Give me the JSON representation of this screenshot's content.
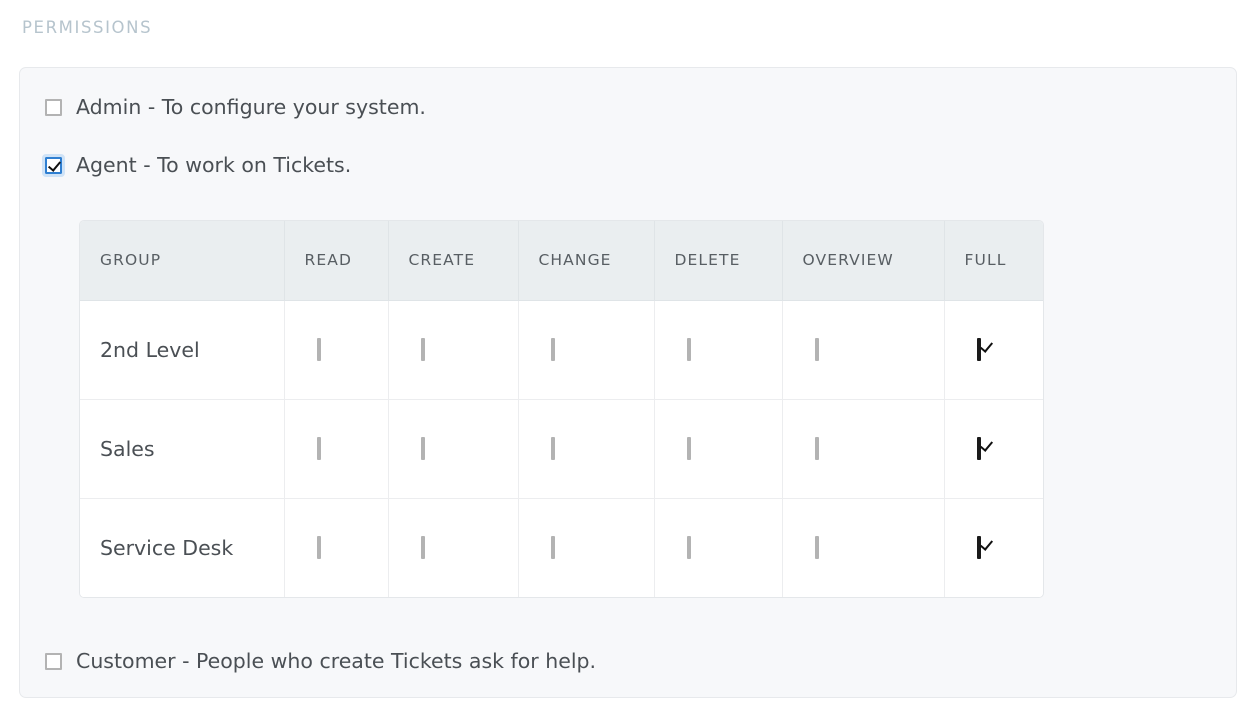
{
  "section": {
    "title": "PERMISSIONS"
  },
  "colors": {
    "heading": "#b6c4cd",
    "panel_background": "#f7f8fa",
    "panel_border": "#e7e9ec",
    "table_header_background": "#eaeef0",
    "table_header_text": "#585e63",
    "text": "#4a4f54",
    "checkbox_border": "#b3b3b3",
    "checkbox_checked_border": "#1a1a1a",
    "checkbox_focus_border": "#2f7fd1",
    "checkbox_focus_glow": "#cfe3f7"
  },
  "permissions": [
    {
      "key": "admin",
      "label": "Admin - To configure your system.",
      "checked": false,
      "focused": false
    },
    {
      "key": "agent",
      "label": "Agent - To work on Tickets.",
      "checked": true,
      "focused": true
    },
    {
      "key": "customer",
      "label": "Customer - People who create Tickets ask for help.",
      "checked": false,
      "focused": false
    }
  ],
  "table": {
    "columns": [
      {
        "key": "group",
        "label": "GROUP"
      },
      {
        "key": "read",
        "label": "READ"
      },
      {
        "key": "create",
        "label": "CREATE"
      },
      {
        "key": "change",
        "label": "CHANGE"
      },
      {
        "key": "delete",
        "label": "DELETE"
      },
      {
        "key": "overview",
        "label": "OVERVIEW"
      },
      {
        "key": "full",
        "label": "FULL"
      }
    ],
    "rows": [
      {
        "group": "2nd Level",
        "read": false,
        "create": false,
        "change": false,
        "delete": false,
        "overview": false,
        "full": true
      },
      {
        "group": "Sales",
        "read": false,
        "create": false,
        "change": false,
        "delete": false,
        "overview": false,
        "full": true
      },
      {
        "group": "Service Desk",
        "read": false,
        "create": false,
        "change": false,
        "delete": false,
        "overview": false,
        "full": true
      }
    ]
  }
}
